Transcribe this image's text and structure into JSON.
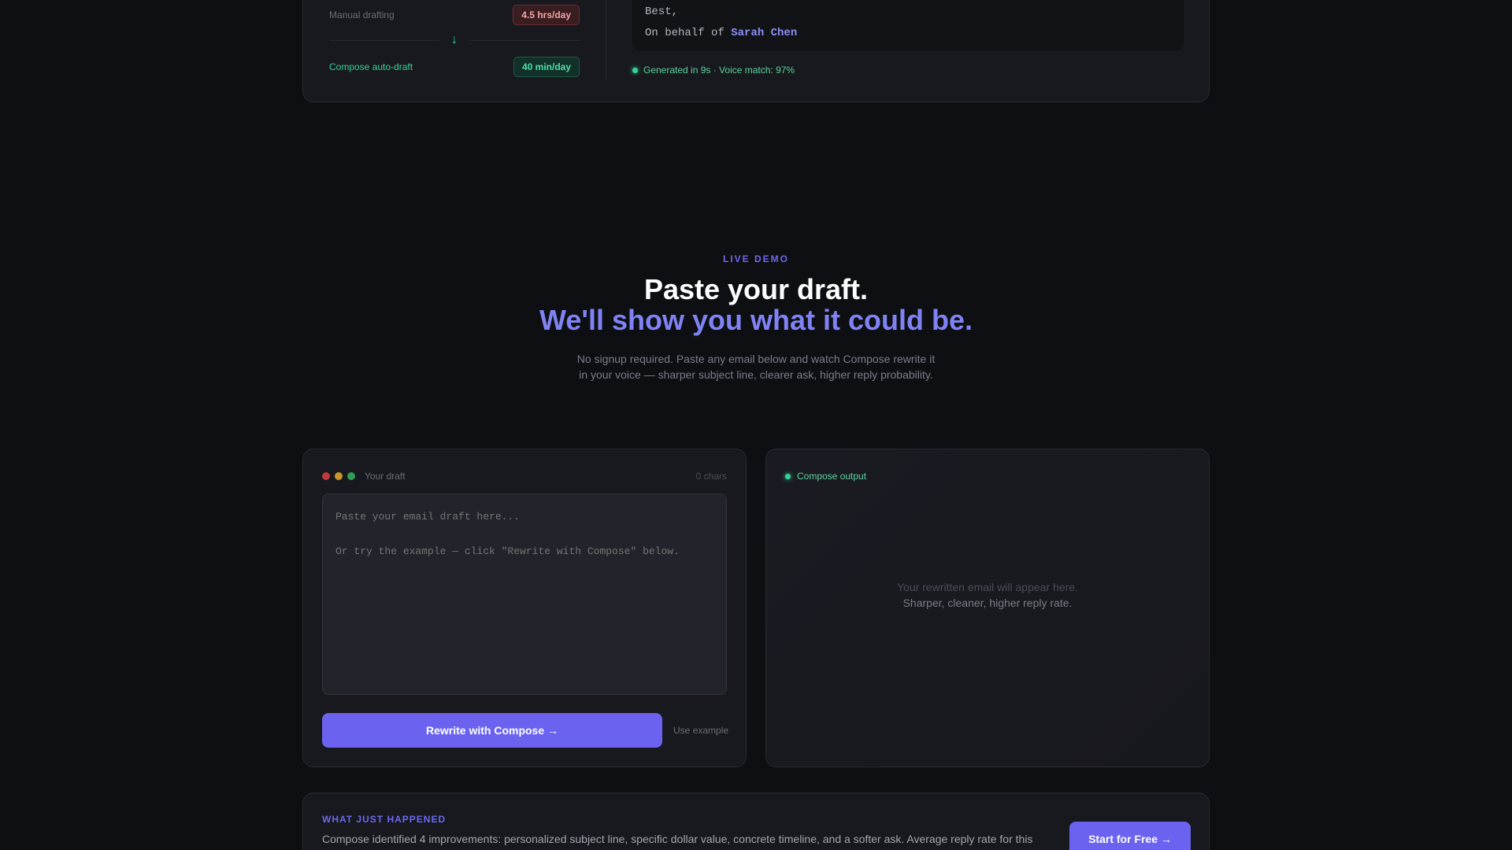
{
  "top_card": {
    "manual_label": "Manual drafting",
    "manual_value": "4.5 hrs/day",
    "compose_label": "Compose auto-draft",
    "compose_value": "40 min/day",
    "email_signoff": "Best,",
    "email_behalf_prefix": "On behalf of ",
    "email_behalf_name": "Sarah Chen",
    "generated_note": "Generated in 9s · Voice match: 97%"
  },
  "hero": {
    "eyebrow": "LIVE DEMO",
    "title_line1": "Paste your draft.",
    "title_line2": "We'll show you what it could be.",
    "subtitle": "No signup required. Paste any email below and watch Compose rewrite it in your voice — sharper subject line, clearer ask, higher reply probability."
  },
  "draft_card": {
    "title": "Your draft",
    "char_count": "0 chars",
    "placeholder": "Paste your email draft here...\n\nOr try the example — click \"Rewrite with Compose\" below.",
    "rewrite_button": "Rewrite with Compose →",
    "use_example": "Use example"
  },
  "output_card": {
    "title": "Compose output",
    "placeholder_line1": "Your rewritten email will appear here.",
    "placeholder_line2": "Sharper, cleaner, higher reply rate."
  },
  "summary": {
    "eyebrow": "WHAT JUST HAPPENED",
    "text": "Compose identified 4 improvements: personalized subject line, specific dollar value, concrete timeline, and a softer ask. Average reply rate for this",
    "cta": "Start for Free →"
  },
  "colors": {
    "accent": "#6b63f0",
    "accent_text": "#8083f3",
    "success": "#34d399",
    "danger": "#f3a3a3"
  }
}
